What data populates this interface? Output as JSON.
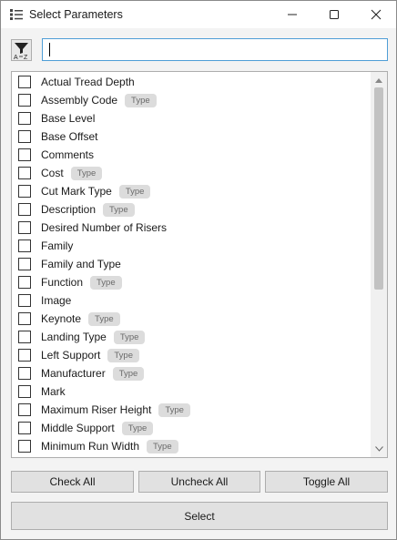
{
  "window": {
    "title": "Select Parameters",
    "controls": {
      "minimize_icon": "minimize-icon",
      "maximize_icon": "maximize-icon",
      "close_icon": "close-icon"
    }
  },
  "toolbar": {
    "filter_icon": "sort-az-filter-icon",
    "search": {
      "value": "",
      "placeholder": ""
    }
  },
  "parameters": [
    {
      "label": "Actual Tread Depth",
      "badge": ""
    },
    {
      "label": "Assembly Code",
      "badge": "Type"
    },
    {
      "label": "Base Level",
      "badge": ""
    },
    {
      "label": "Base Offset",
      "badge": ""
    },
    {
      "label": "Comments",
      "badge": ""
    },
    {
      "label": "Cost",
      "badge": "Type"
    },
    {
      "label": "Cut Mark Type",
      "badge": "Type"
    },
    {
      "label": "Description",
      "badge": "Type"
    },
    {
      "label": "Desired Number of Risers",
      "badge": ""
    },
    {
      "label": "Family",
      "badge": ""
    },
    {
      "label": "Family and Type",
      "badge": ""
    },
    {
      "label": "Function",
      "badge": "Type"
    },
    {
      "label": "Image",
      "badge": ""
    },
    {
      "label": "Keynote",
      "badge": "Type"
    },
    {
      "label": "Landing Type",
      "badge": "Type"
    },
    {
      "label": "Left Support",
      "badge": "Type"
    },
    {
      "label": "Manufacturer",
      "badge": "Type"
    },
    {
      "label": "Mark",
      "badge": ""
    },
    {
      "label": "Maximum Riser Height",
      "badge": "Type"
    },
    {
      "label": "Middle Support",
      "badge": "Type"
    },
    {
      "label": "Minimum Run Width",
      "badge": "Type"
    }
  ],
  "buttons": {
    "check_all": "Check All",
    "uncheck_all": "Uncheck All",
    "toggle_all": "Toggle All",
    "select": "Select"
  },
  "colors": {
    "focus_border": "#4f9ed6",
    "badge_bg": "#dcdcdc",
    "badge_text": "#6a6a6a",
    "button_bg": "#e1e1e1"
  }
}
